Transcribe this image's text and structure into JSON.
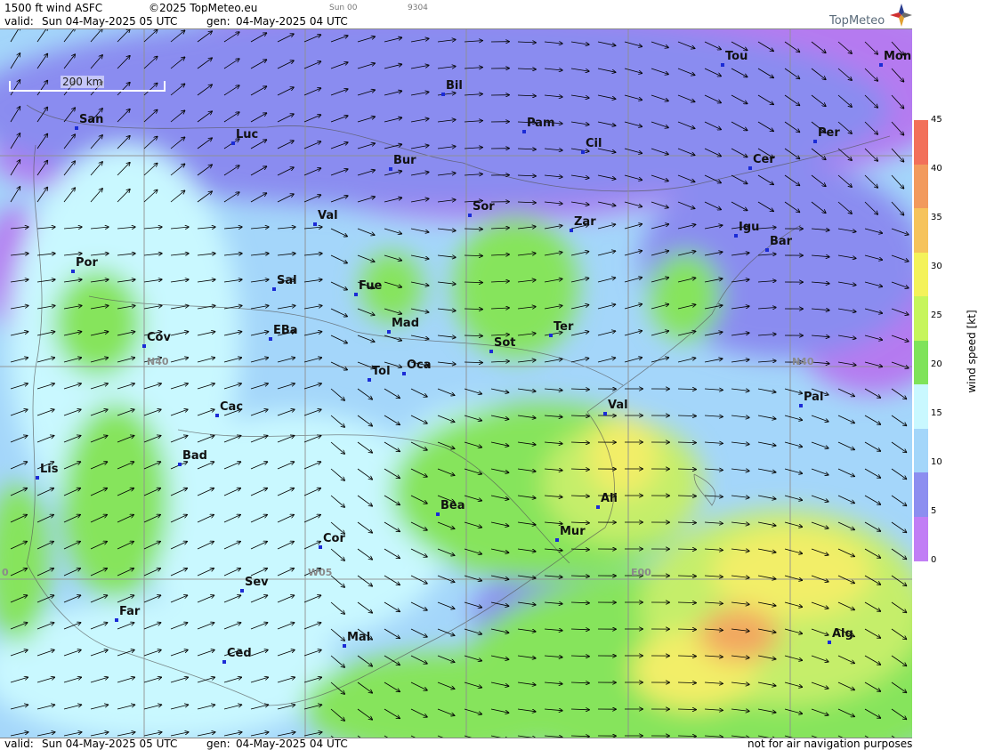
{
  "header": {
    "title": "1500 ft wind ASFC",
    "copyright": "©2025 TopMeteo.eu",
    "valid_label": "valid:",
    "valid": "Sun  04-May-2025  05 UTC",
    "gen_label": "gen:",
    "gen": "04-May-2025 04 UTC",
    "small_day": "Sun 00",
    "small_id": "9304",
    "logo": "TopMeteo"
  },
  "footer": {
    "valid_label": "valid:",
    "valid": "Sun  04-May-2025  05 UTC",
    "gen_label": "gen:",
    "gen": "04-May-2025 04 UTC",
    "disclaimer": "not for air navigation purposes"
  },
  "map": {
    "scale": "200 km",
    "grid_labels": [
      "N40",
      "N40",
      "W05",
      "E00",
      "0"
    ],
    "cities": [
      "Tou",
      "Mon",
      "Bil",
      "San",
      "Luc",
      "Pam",
      "Per",
      "Cil",
      "Bur",
      "Cer",
      "Sor",
      "Val",
      "Zar",
      "Igu",
      "Bar",
      "Por",
      "Sal",
      "Fue",
      "EBa",
      "Cov",
      "Mad",
      "Ter",
      "Sot",
      "Tol",
      "Oca",
      "Pal",
      "Val",
      "Cac",
      "Bad",
      "Lis",
      "Ali",
      "Bea",
      "Mur",
      "Cor",
      "Sev",
      "Far",
      "Mal",
      "Alg",
      "Ced"
    ],
    "colors": {
      "calm": "#b57af0",
      "light": "#8a8cf0",
      "moderate": "#a4d6fa",
      "breeze": "#c9f8ff",
      "fresh": "#86e45c",
      "strong": "#c5ee6a",
      "gale": "#f2ee68",
      "storm": "#f2a760",
      "grid": "#909090",
      "city_dot": "#1b2bd6"
    }
  },
  "legend": {
    "title": "wind speed [kt]",
    "ticks": [
      "45",
      "40",
      "35",
      "30",
      "25",
      "20",
      "15",
      "10",
      "5",
      "0"
    ],
    "colors": [
      "#f2705a",
      "#f29a5d",
      "#f6c35c",
      "#f4f25a",
      "#c6f55c",
      "#7fe35a",
      "#c9f8ff",
      "#a4d6fa",
      "#8c8ef0",
      "#c17ef5"
    ]
  }
}
